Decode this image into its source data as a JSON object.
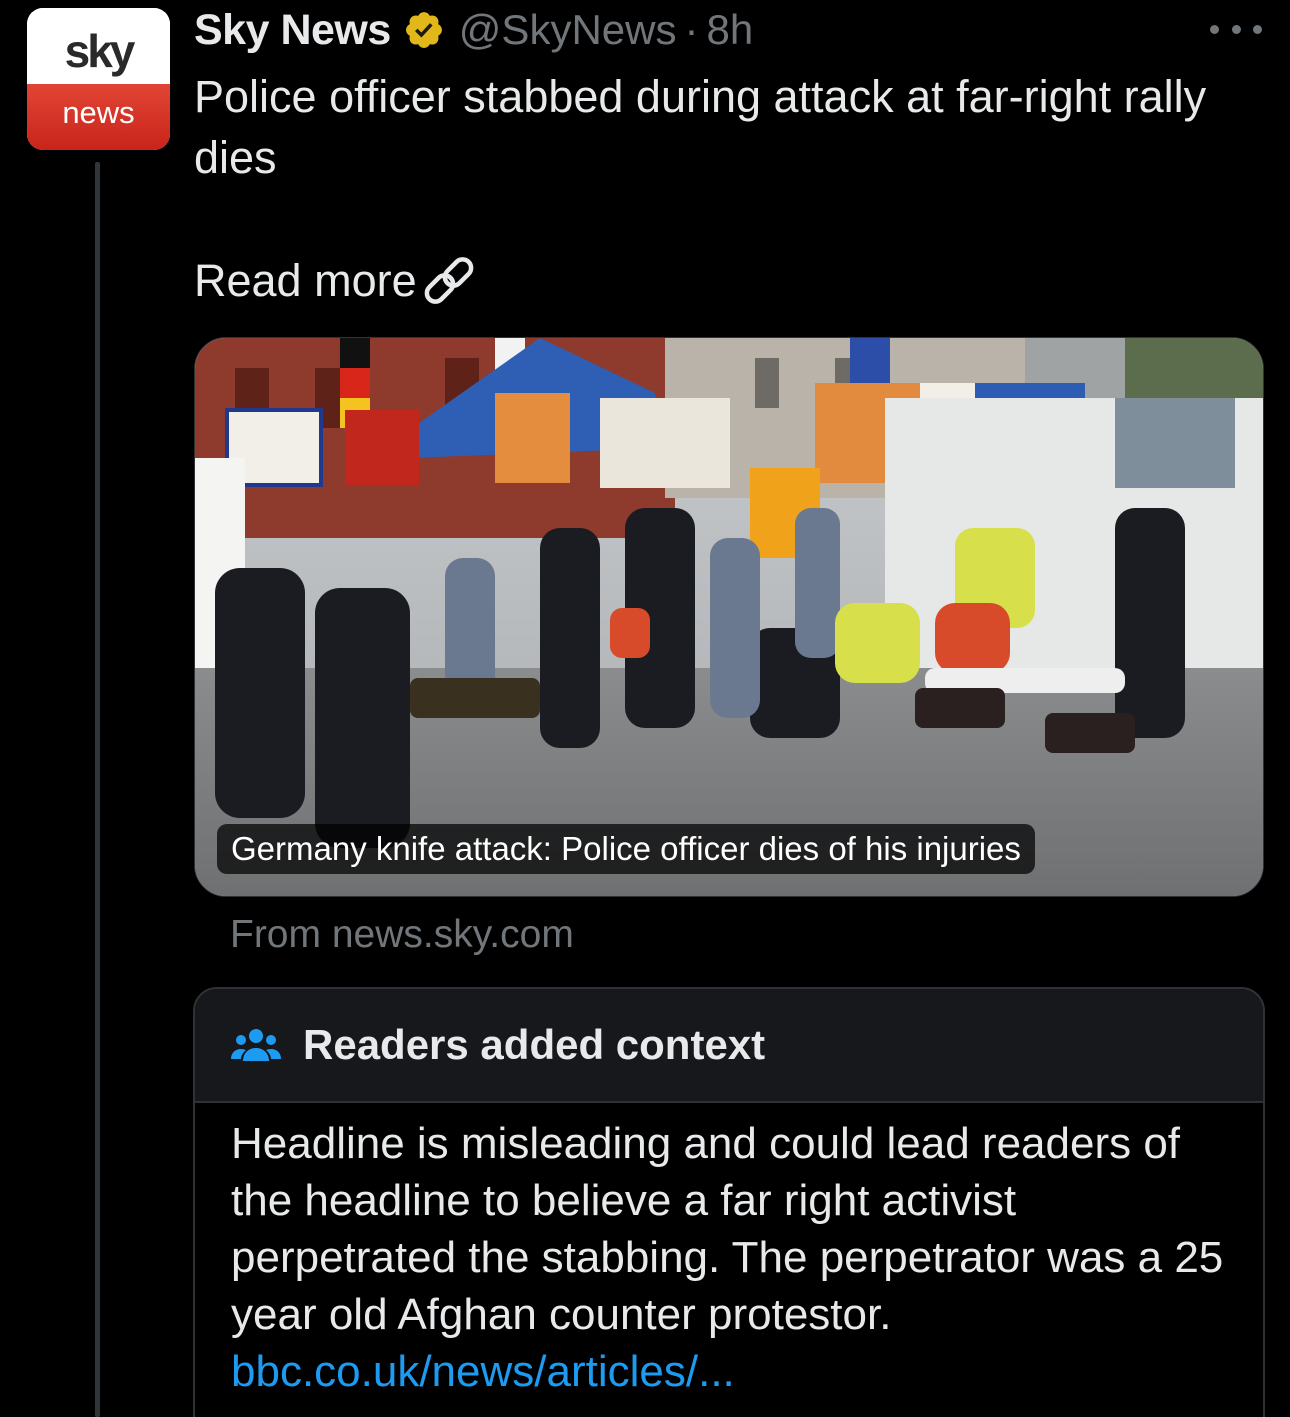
{
  "avatar": {
    "top_text": "sky",
    "bottom_text": "news"
  },
  "header": {
    "name": "Sky News",
    "handle": "@SkyNews",
    "separator": "·",
    "time": "8h",
    "verified_icon": "verified-badge-icon",
    "more_icon": "more-options-icon"
  },
  "tweet": {
    "text": "Police officer stabbed during attack at far-right rally dies",
    "read_more": "Read more",
    "link_icon": "link-icon"
  },
  "card": {
    "caption": "Germany knife attack: Police officer dies of his injuries",
    "source": "From news.sky.com"
  },
  "note": {
    "title": "Readers added context",
    "icon": "people-icon",
    "body": "Headline is misleading and could lead readers of the headline to believe a far right activist perpetrated the stabbing. The perpetrator was a 25 year old Afghan counter protestor.",
    "link": "bbc.co.uk/news/articles/..."
  },
  "colors": {
    "background": "#000000",
    "text_primary": "#e7e9ea",
    "text_secondary": "#71767b",
    "link": "#1d9bf0",
    "verified_gold": "#e2b719",
    "border": "#2f3336",
    "note_header_bg": "#16181c",
    "brand_red": "#d6352a"
  }
}
